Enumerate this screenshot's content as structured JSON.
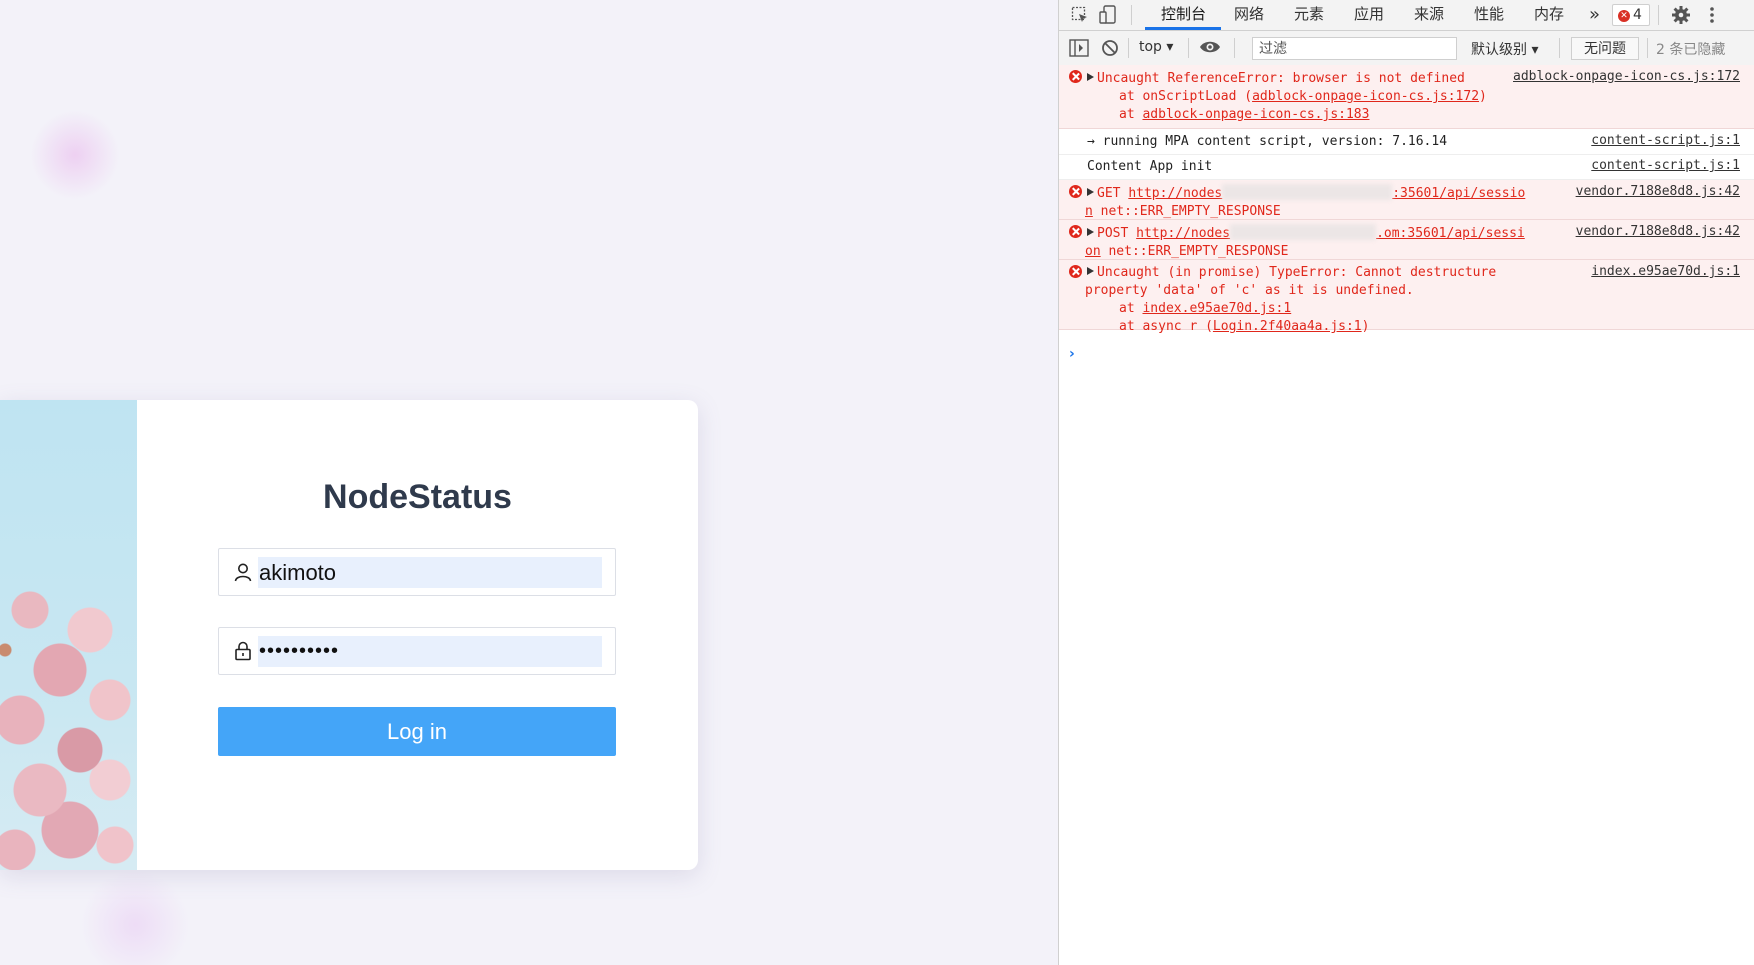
{
  "login": {
    "title": "NodeStatus",
    "username": "akimoto",
    "password_mask": "••••••••••",
    "button_label": "Log in"
  },
  "devtools": {
    "tabs": [
      "控制台",
      "网络",
      "元素",
      "应用",
      "来源",
      "性能",
      "内存"
    ],
    "more_tabs": "»",
    "error_count": "4",
    "context": "top",
    "filter_placeholder": "过滤",
    "level": "默认级别",
    "issues_button": "无问题",
    "hidden_count": "2 条已隐藏",
    "messages": [
      {
        "type": "error",
        "text": "Uncaught ReferenceError: browser is not defined",
        "trace": [
          "at onScriptLoad (",
          "adblock-onpage-icon-cs.js:172",
          ")",
          "at ",
          "adblock-onpage-icon-cs.js:183"
        ],
        "source": "adblock-onpage-icon-cs.js:172"
      },
      {
        "type": "log",
        "text": "→ running MPA content script, version: 7.16.14",
        "source": "content-script.js:1"
      },
      {
        "type": "log",
        "text": "Content App init",
        "source": "content-script.js:1"
      },
      {
        "type": "error",
        "method": "GET",
        "url_start": "http://nodes",
        "url_end": ":35601/api/sessio",
        "url_wrap": "n",
        "status": "net::ERR_EMPTY_RESPONSE",
        "source": "vendor.7188e8d8.js:42"
      },
      {
        "type": "error",
        "method": "POST",
        "url_start": "http://nodes",
        "url_end": ".om:35601/api/sessi",
        "url_wrap": "on",
        "status": "net::ERR_EMPTY_RESPONSE",
        "source": "vendor.7188e8d8.js:42"
      },
      {
        "type": "error",
        "text": "Uncaught (in promise) TypeError: Cannot destructure",
        "text2": "property 'data' of 'c' as it is undefined.",
        "trace1": "index.e95ae70d.js:1",
        "trace2": "Login.2f40aa4a.js:1",
        "trace2_prefix": "at async r (",
        "source": "index.e95ae70d.js:1"
      }
    ],
    "prompt": "›"
  },
  "colors": {
    "accent": "#44a5f8",
    "error": "#e0271b",
    "devtools_tab_active": "#1a73e8"
  }
}
